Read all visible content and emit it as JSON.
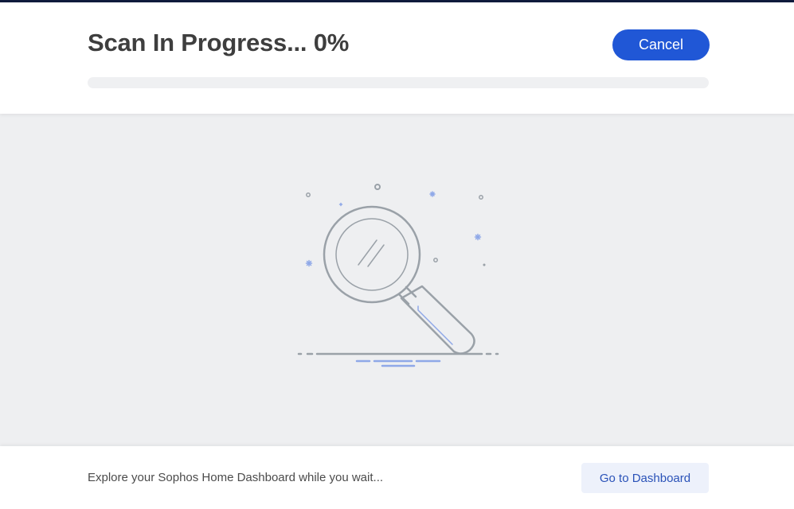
{
  "scan": {
    "title": "Scan In Progress... 0%",
    "progress_percent": 0,
    "cancel_label": "Cancel"
  },
  "illustration": {
    "icon": "magnifying-glass-icon"
  },
  "footer": {
    "message": "Explore your Sophos Home Dashboard while you wait...",
    "dashboard_button_label": "Go to Dashboard"
  },
  "colors": {
    "accent": "#2057d6",
    "top_bar": "#0f1b3d",
    "content_background": "#eeeff1",
    "illustration_stroke": "#9aa1a8",
    "illustration_accent": "#8fa8e8"
  }
}
